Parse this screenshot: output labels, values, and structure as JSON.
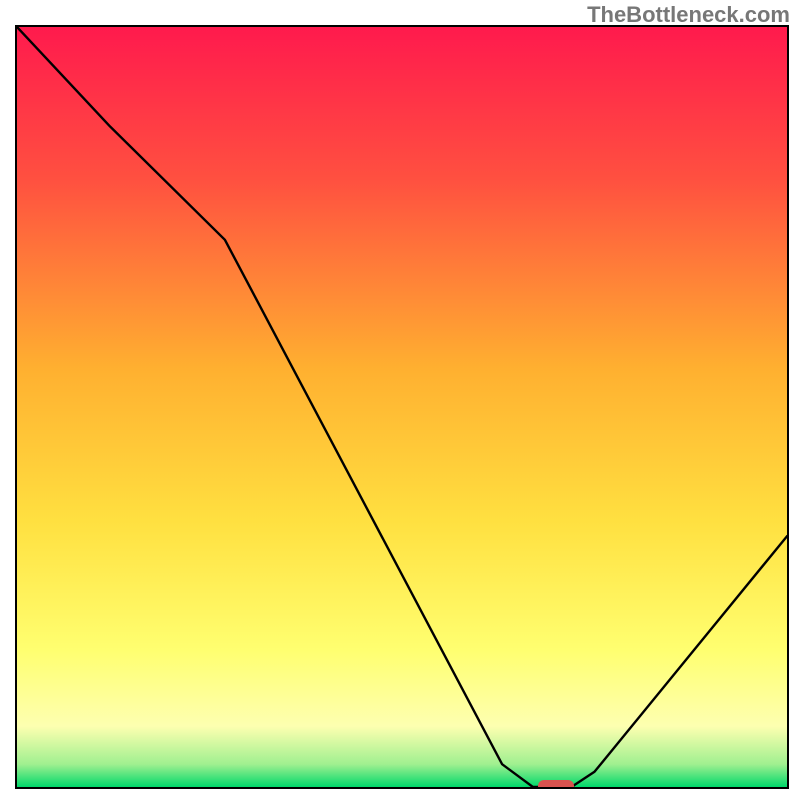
{
  "watermark": "TheBottleneck.com",
  "chart_data": {
    "type": "line",
    "title": "",
    "xlabel": "",
    "ylabel": "",
    "xlim": [
      0,
      100
    ],
    "ylim": [
      0,
      100
    ],
    "series": [
      {
        "name": "bottleneck-curve",
        "x": [
          0,
          12,
          27,
          63,
          67,
          72,
          75,
          100
        ],
        "y": [
          100,
          87,
          72,
          3,
          0,
          0,
          2,
          33
        ],
        "color": "#000000"
      }
    ],
    "marker": {
      "name": "optimal-point",
      "x": 70,
      "y": 0,
      "color": "#d9534f",
      "shape": "pill"
    },
    "background_gradient": {
      "top": "#ff1a4d",
      "mid_upper": "#ff8040",
      "mid": "#ffdd33",
      "mid_lower": "#ffff88",
      "bottom": "#00e676"
    }
  }
}
